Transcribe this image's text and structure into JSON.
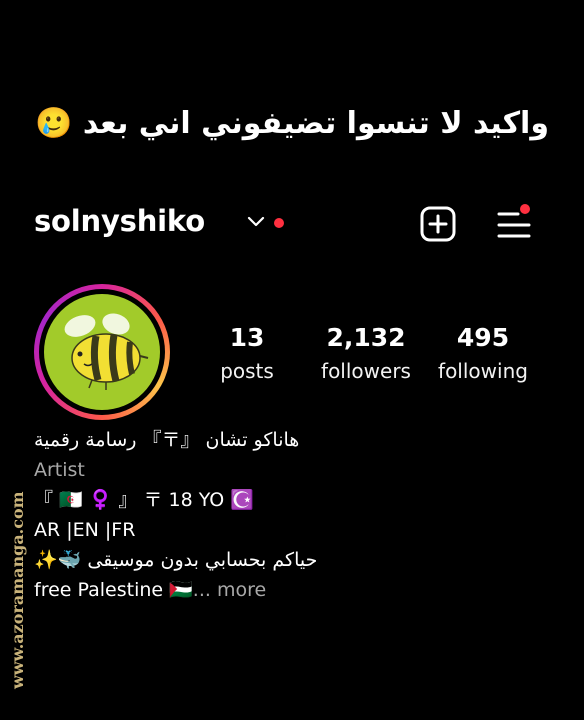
{
  "caption": "واكيد لا تنسوا تضيفوني اني بعد 🥲",
  "profile": {
    "username": "solnyshiko"
  },
  "stats": [
    {
      "value": "13",
      "label": "posts"
    },
    {
      "value": "2,132",
      "label": "followers"
    },
    {
      "value": "495",
      "label": "following"
    }
  ],
  "bio": {
    "name": "هاناكو تشان 『〒』 رسامة رقمية",
    "category": "Artist",
    "line1": "『 🇩🇿 ♀️ 』 〒 18 YO ☪️",
    "line2": "AR |EN |FR",
    "line3": "حياكم بحسابي بدون موسيقى 🐳✨",
    "line4": "free Palestine 🇵🇸",
    "more": "... more"
  },
  "watermark": "www.azoramanga.com",
  "colors": {
    "notification": "#ff3040",
    "secondary_text": "#a8a8a8",
    "avatar_bg": "#a2cb2a"
  }
}
